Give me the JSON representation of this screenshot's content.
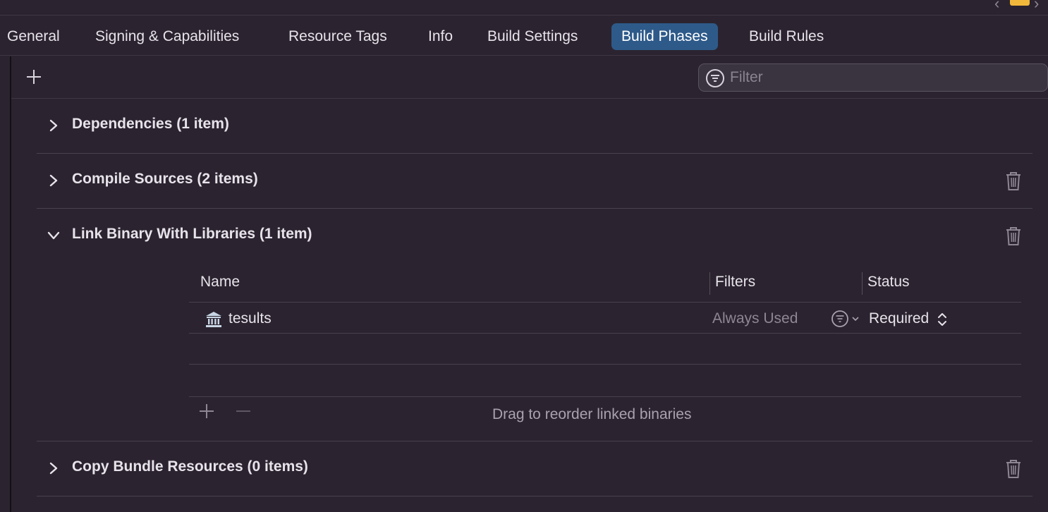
{
  "tabs": [
    {
      "label": "General"
    },
    {
      "label": "Signing & Capabilities"
    },
    {
      "label": "Resource Tags"
    },
    {
      "label": "Info"
    },
    {
      "label": "Build Settings"
    },
    {
      "label": "Build Phases",
      "active": true
    },
    {
      "label": "Build Rules"
    }
  ],
  "toolbar": {
    "filter_placeholder": "Filter",
    "add_icon": "plus-icon",
    "filter_icon": "filter-circle-icon"
  },
  "sections": {
    "dependencies": {
      "title": "Dependencies (1 item)",
      "expanded": false
    },
    "compile_sources": {
      "title": "Compile Sources (2 items)",
      "expanded": false
    },
    "link_binary": {
      "title": "Link Binary With Libraries (1 item)",
      "expanded": true
    },
    "copy_bundle": {
      "title": "Copy Bundle Resources (0 items)",
      "expanded": false
    }
  },
  "link_table": {
    "columns": {
      "name": "Name",
      "filters": "Filters",
      "status": "Status"
    },
    "rows": [
      {
        "name": "tesults",
        "filters": "Always Used",
        "status": "Required",
        "icon": "library-icon"
      }
    ],
    "drag_hint": "Drag to reorder linked binaries"
  },
  "colors": {
    "background": "#2b2430",
    "active_tab": "#2e5a8a",
    "text": "#e7e3ea",
    "muted_text": "#8e8793",
    "warning": "#f2b83b"
  }
}
